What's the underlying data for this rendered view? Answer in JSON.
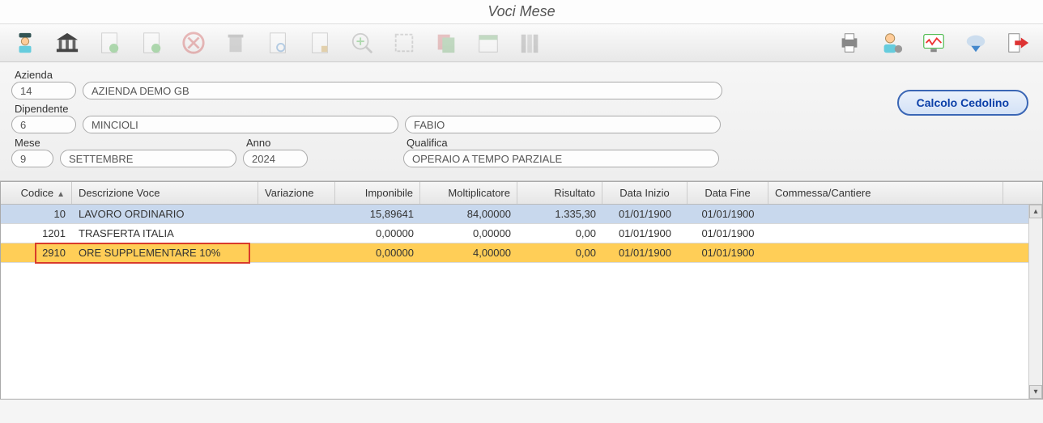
{
  "window": {
    "title": "Voci Mese"
  },
  "toolbar": {
    "icons": [
      "employee-icon",
      "bank-icon",
      "doc-plus-icon",
      "doc-edit-icon",
      "cancel-icon",
      "trash-icon",
      "doc-search-icon",
      "doc-lock-icon",
      "zoom-in-icon",
      "frame-icon",
      "copy-icon",
      "calendar-icon",
      "books-icon",
      "spacer",
      "printer-icon",
      "person-cog-icon",
      "monitor-icon",
      "cloud-down-icon",
      "exit-icon"
    ]
  },
  "form": {
    "azienda_label": "Azienda",
    "azienda_code": "14",
    "azienda_name": "AZIENDA DEMO GB",
    "dipendente_label": "Dipendente",
    "dipendente_code": "6",
    "dipendente_surname": "MINCIOLI",
    "dipendente_name": "FABIO",
    "mese_label": "Mese",
    "mese_code": "9",
    "mese_name": "SETTEMBRE",
    "anno_label": "Anno",
    "anno_value": "2024",
    "qualifica_label": "Qualifica",
    "qualifica_value": "OPERAIO A TEMPO PARZIALE",
    "calcolo_btn": "Calcolo Cedolino"
  },
  "grid": {
    "columns": {
      "codice": "Codice",
      "descrizione": "Descrizione Voce",
      "variazione": "Variazione",
      "imponibile": "Imponibile",
      "moltiplicatore": "Moltiplicatore",
      "risultato": "Risultato",
      "data_inizio": "Data Inizio",
      "data_fine": "Data Fine",
      "commessa": "Commessa/Cantiere"
    },
    "sort_indicator": "▲",
    "rows": [
      {
        "codice": "10",
        "descrizione": "LAVORO ORDINARIO",
        "variazione": "",
        "imponibile": "15,89641",
        "moltiplicatore": "84,00000",
        "risultato": "1.335,30",
        "data_inizio": "01/01/1900",
        "data_fine": "01/01/1900",
        "commessa": ""
      },
      {
        "codice": "1201",
        "descrizione": "TRASFERTA ITALIA",
        "variazione": "",
        "imponibile": "0,00000",
        "moltiplicatore": "0,00000",
        "risultato": "0,00",
        "data_inizio": "01/01/1900",
        "data_fine": "01/01/1900",
        "commessa": ""
      },
      {
        "codice": "2910",
        "descrizione": "ORE SUPPLEMENTARE 10%",
        "variazione": "",
        "imponibile": "0,00000",
        "moltiplicatore": "4,00000",
        "risultato": "0,00",
        "data_inizio": "01/01/1900",
        "data_fine": "01/01/1900",
        "commessa": ""
      }
    ]
  }
}
